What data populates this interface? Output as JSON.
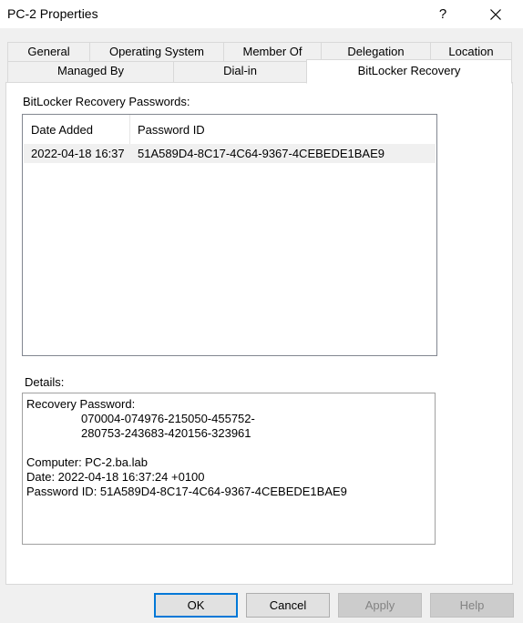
{
  "window": {
    "title": "PC-2 Properties",
    "help_label": "?",
    "close_label": "✕"
  },
  "tabs_row1": [
    {
      "label": "General"
    },
    {
      "label": "Operating System"
    },
    {
      "label": "Member Of"
    },
    {
      "label": "Delegation"
    },
    {
      "label": "Location"
    }
  ],
  "tabs_row2": [
    {
      "label": "Managed By"
    },
    {
      "label": "Dial-in"
    },
    {
      "label": "BitLocker Recovery",
      "active": true
    }
  ],
  "main": {
    "list_label": "BitLocker Recovery Passwords:",
    "columns": [
      "Date Added",
      "Password ID"
    ],
    "rows": [
      {
        "date_added": "2022-04-18 16:37",
        "password_id": "51A589D4-8C17-4C64-9367-4CEBEDE1BAE9"
      }
    ],
    "details_label": "Details:",
    "details": {
      "recovery_password_label": "Recovery Password:",
      "recovery_password_line1": "070004-074976-215050-455752-",
      "recovery_password_line2": "280753-243683-420156-323961",
      "computer_line": "Computer: PC-2.ba.lab",
      "date_line": "Date: 2022-04-18 16:37:24 +0100",
      "password_id_line": "Password ID: 51A589D4-8C17-4C64-9367-4CEBEDE1BAE9"
    }
  },
  "buttons": {
    "ok": "OK",
    "cancel": "Cancel",
    "apply": "Apply",
    "help": "Help"
  },
  "colors": {
    "focus_border": "#0078d7",
    "selected_row": "#f0f0f0"
  }
}
